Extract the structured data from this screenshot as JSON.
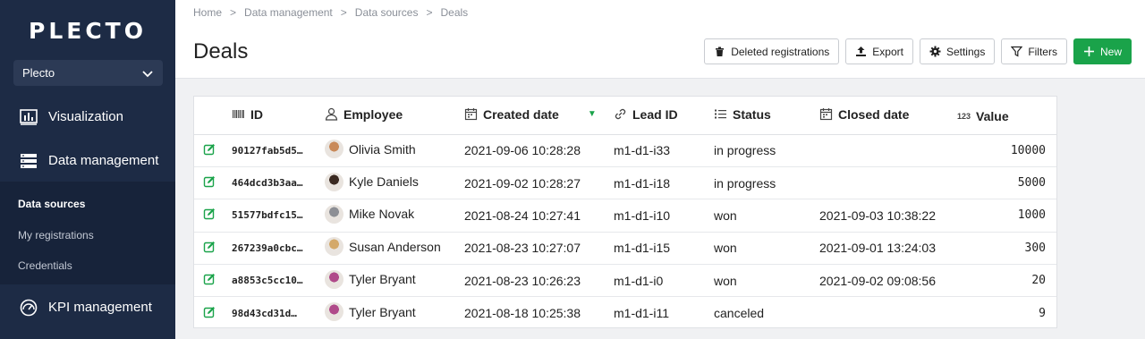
{
  "sidebar": {
    "logo": "PLECTO",
    "org": "Plecto",
    "nav": {
      "visualization": "Visualization",
      "data_management": "Data management",
      "kpi_management": "KPI management"
    },
    "sub": {
      "data_sources": "Data sources",
      "my_registrations": "My registrations",
      "credentials": "Credentials"
    }
  },
  "breadcrumb": [
    "Home",
    "Data management",
    "Data sources",
    "Deals"
  ],
  "page_title": "Deals",
  "toolbar": {
    "deleted": "Deleted registrations",
    "export": "Export",
    "settings": "Settings",
    "filters": "Filters",
    "new": "New"
  },
  "table": {
    "headers": {
      "id": "ID",
      "employee": "Employee",
      "created": "Created date",
      "lead": "Lead ID",
      "status": "Status",
      "closed": "Closed date",
      "value": "Value"
    },
    "value_icon_text": "123",
    "rows": [
      {
        "id": "90127fab5d5…",
        "employee": "Olivia Smith",
        "created": "2021-09-06 10:28:28",
        "lead": "m1-d1-i33",
        "status": "in progress",
        "closed": "",
        "value": "10000",
        "avatar": "#c98a5a"
      },
      {
        "id": "464dcd3b3aa…",
        "employee": "Kyle Daniels",
        "created": "2021-09-02 10:28:27",
        "lead": "m1-d1-i18",
        "status": "in progress",
        "closed": "",
        "value": "5000",
        "avatar": "#3b2a22"
      },
      {
        "id": "51577bdfc15…",
        "employee": "Mike Novak",
        "created": "2021-08-24 10:27:41",
        "lead": "m1-d1-i10",
        "status": "won",
        "closed": "2021-09-03 10:38:22",
        "value": "1000",
        "avatar": "#8d8f95"
      },
      {
        "id": "267239a0cbc…",
        "employee": "Susan Anderson",
        "created": "2021-08-23 10:27:07",
        "lead": "m1-d1-i15",
        "status": "won",
        "closed": "2021-09-01 13:24:03",
        "value": "300",
        "avatar": "#d4a96a"
      },
      {
        "id": "a8853c5cc10…",
        "employee": "Tyler Bryant",
        "created": "2021-08-23 10:26:23",
        "lead": "m1-d1-i0",
        "status": "won",
        "closed": "2021-09-02 09:08:56",
        "value": "20",
        "avatar": "#b04a8a"
      },
      {
        "id": "98d43cd31d…",
        "employee": "Tyler Bryant",
        "created": "2021-08-18 10:25:38",
        "lead": "m1-d1-i11",
        "status": "canceled",
        "closed": "",
        "value": "9",
        "avatar": "#b04a8a"
      }
    ]
  },
  "colors": {
    "sidebar": "#1d2b45",
    "accent": "#1aa34a"
  }
}
